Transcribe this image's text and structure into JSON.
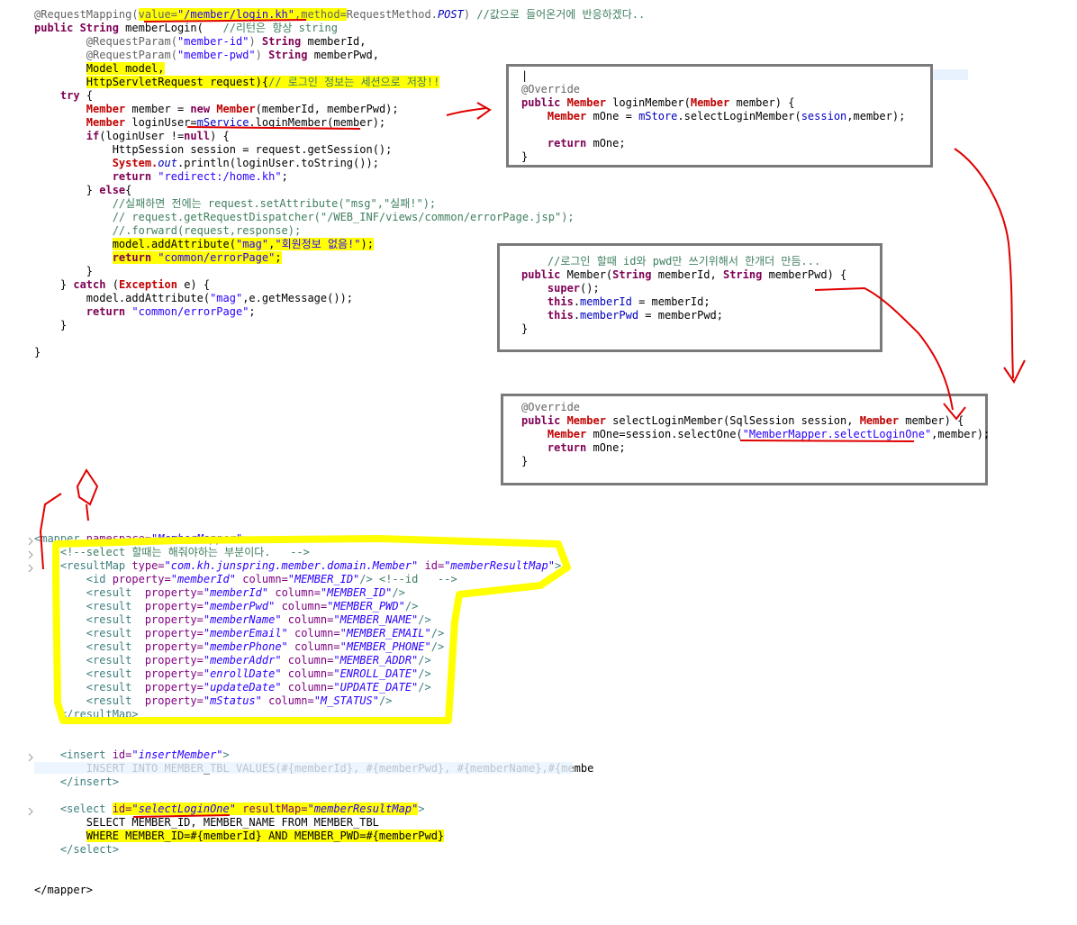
{
  "controller": {
    "lines": [
      [
        [
          "an",
          "@RequestMapping("
        ],
        [
          "an hl",
          "value="
        ],
        [
          "str hl",
          "\"/member/login.kh\""
        ],
        [
          "an hl",
          ",method="
        ],
        [
          "an",
          "RequestMethod."
        ],
        [
          "fld it",
          "POST"
        ],
        [
          "an",
          ") "
        ],
        [
          "cm",
          "//값으로 들어온거에 반응하겠다.."
        ]
      ],
      [
        [
          "kw",
          "public "
        ],
        [
          "ty",
          "String "
        ],
        [
          "",
          "memberLogin(   "
        ],
        [
          "cm",
          "//리턴은 항상 string"
        ]
      ],
      [
        [
          "",
          "        "
        ],
        [
          "an",
          "@RequestParam("
        ],
        [
          "str",
          "\"member-id\""
        ],
        [
          "an",
          ") "
        ],
        [
          "ty",
          "String "
        ],
        [
          "",
          "memberId,"
        ]
      ],
      [
        [
          "",
          "        "
        ],
        [
          "an",
          "@RequestParam("
        ],
        [
          "str",
          "\"member-pwd\""
        ],
        [
          "an",
          ") "
        ],
        [
          "ty",
          "String "
        ],
        [
          "",
          "memberPwd,"
        ]
      ],
      [
        [
          "",
          "        "
        ],
        [
          "hl",
          "Model model,"
        ]
      ],
      [
        [
          "",
          "        "
        ],
        [
          "hl",
          "HttpServletRequest request){"
        ],
        [
          "cm hl",
          "// 로그인 정보는 세션으로 저장!!"
        ]
      ],
      [
        [
          "",
          "    "
        ],
        [
          "kw",
          "try "
        ],
        [
          "",
          "{"
        ]
      ],
      [
        [
          "",
          "        "
        ],
        [
          "red",
          "Member "
        ],
        [
          "",
          "member = "
        ],
        [
          "kw",
          "new "
        ],
        [
          "red",
          "Member"
        ],
        [
          "",
          "(memberId, memberPwd);"
        ]
      ],
      [
        [
          "",
          "        "
        ],
        [
          "red",
          "Member "
        ],
        [
          "",
          "loginUser="
        ],
        [
          "fld",
          "mService"
        ],
        [
          "",
          ".loginMember(member);"
        ]
      ],
      [
        [
          "",
          "        "
        ],
        [
          "kw",
          "if"
        ],
        [
          "",
          "(loginUser !="
        ],
        [
          "kw",
          "null"
        ],
        [
          "",
          ") {"
        ]
      ],
      [
        [
          "",
          "            "
        ],
        [
          "",
          "HttpSession "
        ],
        [
          "",
          "session = request.getSession();"
        ]
      ],
      [
        [
          "",
          "            "
        ],
        [
          "red",
          "System."
        ],
        [
          "fld it",
          "out"
        ],
        [
          "",
          ".println(loginUser.toString());"
        ]
      ],
      [
        [
          "",
          "            "
        ],
        [
          "kw",
          "return "
        ],
        [
          "str",
          "\"redirect:/home.kh\""
        ],
        [
          "",
          ";"
        ]
      ],
      [
        [
          "",
          "        "
        ],
        [
          "",
          "} "
        ],
        [
          "kw",
          "else"
        ],
        [
          "",
          "{"
        ]
      ],
      [
        [
          "",
          "            "
        ],
        [
          "cm",
          "//실패하면 전에는 request.setAttribute(\"msg\",\"실패!\");"
        ]
      ],
      [
        [
          "",
          "            "
        ],
        [
          "cm",
          "// request.getRequestDispatcher(\"/WEB_INF/views/common/errorPage.jsp\");"
        ]
      ],
      [
        [
          "",
          "            "
        ],
        [
          "cm",
          "//.forward(request,response);"
        ]
      ],
      [
        [
          "",
          "            "
        ],
        [
          "hl",
          "model.addAttribute("
        ],
        [
          "str hl",
          "\"mag\""
        ],
        [
          "hl",
          ","
        ],
        [
          "str hl",
          "\"회원정보 없음!\""
        ],
        [
          "hl",
          ");"
        ]
      ],
      [
        [
          "",
          "            "
        ],
        [
          "kw hl",
          "return "
        ],
        [
          "str hl",
          "\"common/errorPage\""
        ],
        [
          "hl",
          ";"
        ]
      ],
      [
        [
          "",
          "        "
        ],
        [
          "",
          "}"
        ]
      ],
      [
        [
          "",
          "    "
        ],
        [
          "",
          "} "
        ],
        [
          "kw",
          "catch "
        ],
        [
          "",
          "("
        ],
        [
          "red",
          "Exception "
        ],
        [
          "",
          "e) {"
        ]
      ],
      [
        [
          "",
          "        "
        ],
        [
          "",
          "model.addAttribute("
        ],
        [
          "str",
          "\"mag\""
        ],
        [
          "",
          ",e.getMessage());"
        ]
      ],
      [
        [
          "",
          "        "
        ],
        [
          "kw",
          "return "
        ],
        [
          "str",
          "\"common/errorPage\""
        ],
        [
          "",
          ";"
        ]
      ],
      [
        [
          "",
          "    "
        ],
        [
          "",
          "}"
        ]
      ],
      [
        [
          "",
          ""
        ]
      ],
      [
        [
          "",
          "}"
        ]
      ]
    ]
  },
  "box_service": {
    "lines": [
      [
        [
          "",
          "|"
        ]
      ],
      [
        [
          "an",
          "@Override"
        ]
      ],
      [
        [
          "kw",
          "public "
        ],
        [
          "red",
          "Member "
        ],
        [
          "",
          "loginMember("
        ],
        [
          "red",
          "Member "
        ],
        [
          "",
          "member) {"
        ]
      ],
      [
        [
          "",
          "    "
        ],
        [
          "red",
          "Member "
        ],
        [
          "",
          "mOne = "
        ],
        [
          "fld",
          "mStore"
        ],
        [
          "",
          ".selectLoginMember("
        ],
        [
          "fld",
          "session"
        ],
        [
          "",
          ",member);"
        ]
      ],
      [
        [
          "",
          ""
        ]
      ],
      [
        [
          "",
          "    "
        ],
        [
          "kw",
          "return "
        ],
        [
          "",
          "mOne;"
        ]
      ],
      [
        [
          "",
          "}"
        ]
      ]
    ]
  },
  "box_domain": {
    "lines": [
      [
        [
          "",
          "    "
        ],
        [
          "cm",
          "//로그인 할때 id와 pwd만 쓰기위해서 한개더 만듬..."
        ]
      ],
      [
        [
          "kw",
          "public "
        ],
        [
          "",
          "Member("
        ],
        [
          "ty",
          "String "
        ],
        [
          "",
          "memberId, "
        ],
        [
          "ty",
          "String "
        ],
        [
          "",
          "memberPwd) {"
        ]
      ],
      [
        [
          "",
          "    "
        ],
        [
          "kw",
          "super"
        ],
        [
          "",
          "();"
        ]
      ],
      [
        [
          "",
          "    "
        ],
        [
          "kw",
          "this"
        ],
        [
          "",
          "."
        ],
        [
          "fld",
          "memberId "
        ],
        [
          "",
          "= memberId;"
        ]
      ],
      [
        [
          "",
          "    "
        ],
        [
          "kw",
          "this"
        ],
        [
          "",
          "."
        ],
        [
          "fld",
          "memberPwd "
        ],
        [
          "",
          "= memberPwd;"
        ]
      ],
      [
        [
          "",
          "}"
        ]
      ]
    ]
  },
  "box_store": {
    "lines": [
      [
        [
          "an",
          "@Override"
        ]
      ],
      [
        [
          "kw",
          "public "
        ],
        [
          "red",
          "Member "
        ],
        [
          "",
          "selectLoginMember(SqlSession session, "
        ],
        [
          "red",
          "Member "
        ],
        [
          "",
          "member) {"
        ]
      ],
      [
        [
          "",
          "    "
        ],
        [
          "red",
          "Member "
        ],
        [
          "",
          "mOne=session.selectOne("
        ],
        [
          "str",
          "\"MemberMapper.selectLoginOne\""
        ],
        [
          "",
          ",member);"
        ]
      ],
      [
        [
          "",
          "    "
        ],
        [
          "kw",
          "return "
        ],
        [
          "",
          "mOne;"
        ]
      ],
      [
        [
          "",
          "}"
        ]
      ]
    ]
  },
  "mapper": {
    "lines": [
      [
        [
          "tag",
          "<mapper "
        ],
        [
          "attr",
          "namespace="
        ],
        [
          "aval",
          "\"MemberMapper\""
        ],
        [
          "tag",
          ">"
        ]
      ],
      [
        [
          "",
          "    "
        ],
        [
          "cm",
          "<!--select 할때는 해줘야하는 부분이다.   -->"
        ]
      ],
      [
        [
          "",
          "    "
        ],
        [
          "tag",
          "<resultMap "
        ],
        [
          "attr",
          "type="
        ],
        [
          "aval",
          "\"com.kh.junspring.member.domain.Member\" "
        ],
        [
          "attr",
          "id="
        ],
        [
          "aval",
          "\"memberResultMap\""
        ],
        [
          "tag",
          ">"
        ]
      ],
      [
        [
          "",
          "        "
        ],
        [
          "tag",
          "<id "
        ],
        [
          "attr",
          "property="
        ],
        [
          "aval",
          "\"memberId\" "
        ],
        [
          "attr",
          "column="
        ],
        [
          "aval",
          "\"MEMBER_ID\""
        ],
        [
          "tag",
          "/> "
        ],
        [
          "cm",
          "<!--id   -->"
        ]
      ],
      [
        [
          "",
          "        "
        ],
        [
          "tag",
          "<result  "
        ],
        [
          "attr",
          "property="
        ],
        [
          "aval",
          "\"memberId\" "
        ],
        [
          "attr",
          "column="
        ],
        [
          "aval",
          "\"MEMBER_ID\""
        ],
        [
          "tag",
          "/>"
        ]
      ],
      [
        [
          "",
          "        "
        ],
        [
          "tag",
          "<result  "
        ],
        [
          "attr",
          "property="
        ],
        [
          "aval",
          "\"memberPwd\" "
        ],
        [
          "attr",
          "column="
        ],
        [
          "aval",
          "\"MEMBER_PWD\""
        ],
        [
          "tag",
          "/>"
        ]
      ],
      [
        [
          "",
          "        "
        ],
        [
          "tag",
          "<result  "
        ],
        [
          "attr",
          "property="
        ],
        [
          "aval",
          "\"memberName\" "
        ],
        [
          "attr",
          "column="
        ],
        [
          "aval",
          "\"MEMBER_NAME\""
        ],
        [
          "tag",
          "/>"
        ]
      ],
      [
        [
          "",
          "        "
        ],
        [
          "tag",
          "<result  "
        ],
        [
          "attr",
          "property="
        ],
        [
          "aval",
          "\"memberEmail\" "
        ],
        [
          "attr",
          "column="
        ],
        [
          "aval",
          "\"MEMBER_EMAIL\""
        ],
        [
          "tag",
          "/>"
        ]
      ],
      [
        [
          "",
          "        "
        ],
        [
          "tag",
          "<result  "
        ],
        [
          "attr",
          "property="
        ],
        [
          "aval",
          "\"memberPhone\" "
        ],
        [
          "attr",
          "column="
        ],
        [
          "aval",
          "\"MEMBER_PHONE\""
        ],
        [
          "tag",
          "/>"
        ]
      ],
      [
        [
          "",
          "        "
        ],
        [
          "tag",
          "<result  "
        ],
        [
          "attr",
          "property="
        ],
        [
          "aval",
          "\"memberAddr\" "
        ],
        [
          "attr",
          "column="
        ],
        [
          "aval",
          "\"MEMBER_ADDR\""
        ],
        [
          "tag",
          "/>"
        ]
      ],
      [
        [
          "",
          "        "
        ],
        [
          "tag",
          "<result  "
        ],
        [
          "attr",
          "property="
        ],
        [
          "aval",
          "\"enrollDate\" "
        ],
        [
          "attr",
          "column="
        ],
        [
          "aval",
          "\"ENROLL_DATE\""
        ],
        [
          "tag",
          "/>"
        ]
      ],
      [
        [
          "",
          "        "
        ],
        [
          "tag",
          "<result  "
        ],
        [
          "attr",
          "property="
        ],
        [
          "aval",
          "\"updateDate\" "
        ],
        [
          "attr",
          "column="
        ],
        [
          "aval",
          "\"UPDATE_DATE\""
        ],
        [
          "tag",
          "/>"
        ]
      ],
      [
        [
          "",
          "        "
        ],
        [
          "tag",
          "<result  "
        ],
        [
          "attr",
          "property="
        ],
        [
          "aval",
          "\"mStatus\" "
        ],
        [
          "attr",
          "column="
        ],
        [
          "aval",
          "\"M_STATUS\""
        ],
        [
          "tag",
          "/>"
        ]
      ],
      [
        [
          "",
          "    "
        ],
        [
          "tag",
          "</resultMap>"
        ]
      ],
      [
        [
          "",
          ""
        ]
      ],
      [
        [
          "",
          ""
        ]
      ],
      [
        [
          "",
          "    "
        ],
        [
          "tag",
          "<insert "
        ],
        [
          "attr",
          "id="
        ],
        [
          "aval",
          "\"insertMember\""
        ],
        [
          "tag",
          ">"
        ]
      ],
      [
        [
          "",
          "        "
        ],
        [
          "sql",
          "INSERT INTO MEMBER_TBL VALUES(#{memberId}, #{memberPwd}, #{memberName},#{membe"
        ]
      ],
      [
        [
          "",
          "    "
        ],
        [
          "tag",
          "</insert>"
        ]
      ],
      [
        [
          "",
          ""
        ]
      ],
      [
        [
          "",
          "    "
        ],
        [
          "tag",
          "<select "
        ],
        [
          "attr hl",
          "id="
        ],
        [
          "aval hl",
          "\"selectLoginOne\" "
        ],
        [
          "attr hl",
          "resultMap="
        ],
        [
          "aval hl",
          "\"memberResultMap\""
        ],
        [
          "tag",
          ">"
        ]
      ],
      [
        [
          "",
          "        "
        ],
        [
          "sql",
          "SELECT MEMBER_ID, MEMBER_NAME FROM MEMBER_TBL"
        ]
      ],
      [
        [
          "",
          "        "
        ],
        [
          "sql hl",
          "WHERE MEMBER_ID=#{memberId} AND MEMBER_PWD=#{memberPwd}"
        ]
      ],
      [
        [
          "",
          "    "
        ],
        [
          "tag",
          "</select>"
        ]
      ],
      [
        [
          "",
          ""
        ]
      ],
      [
        [
          "",
          ""
        ]
      ],
      [
        [
          "",
          "</mapper>"
        ]
      ]
    ]
  }
}
